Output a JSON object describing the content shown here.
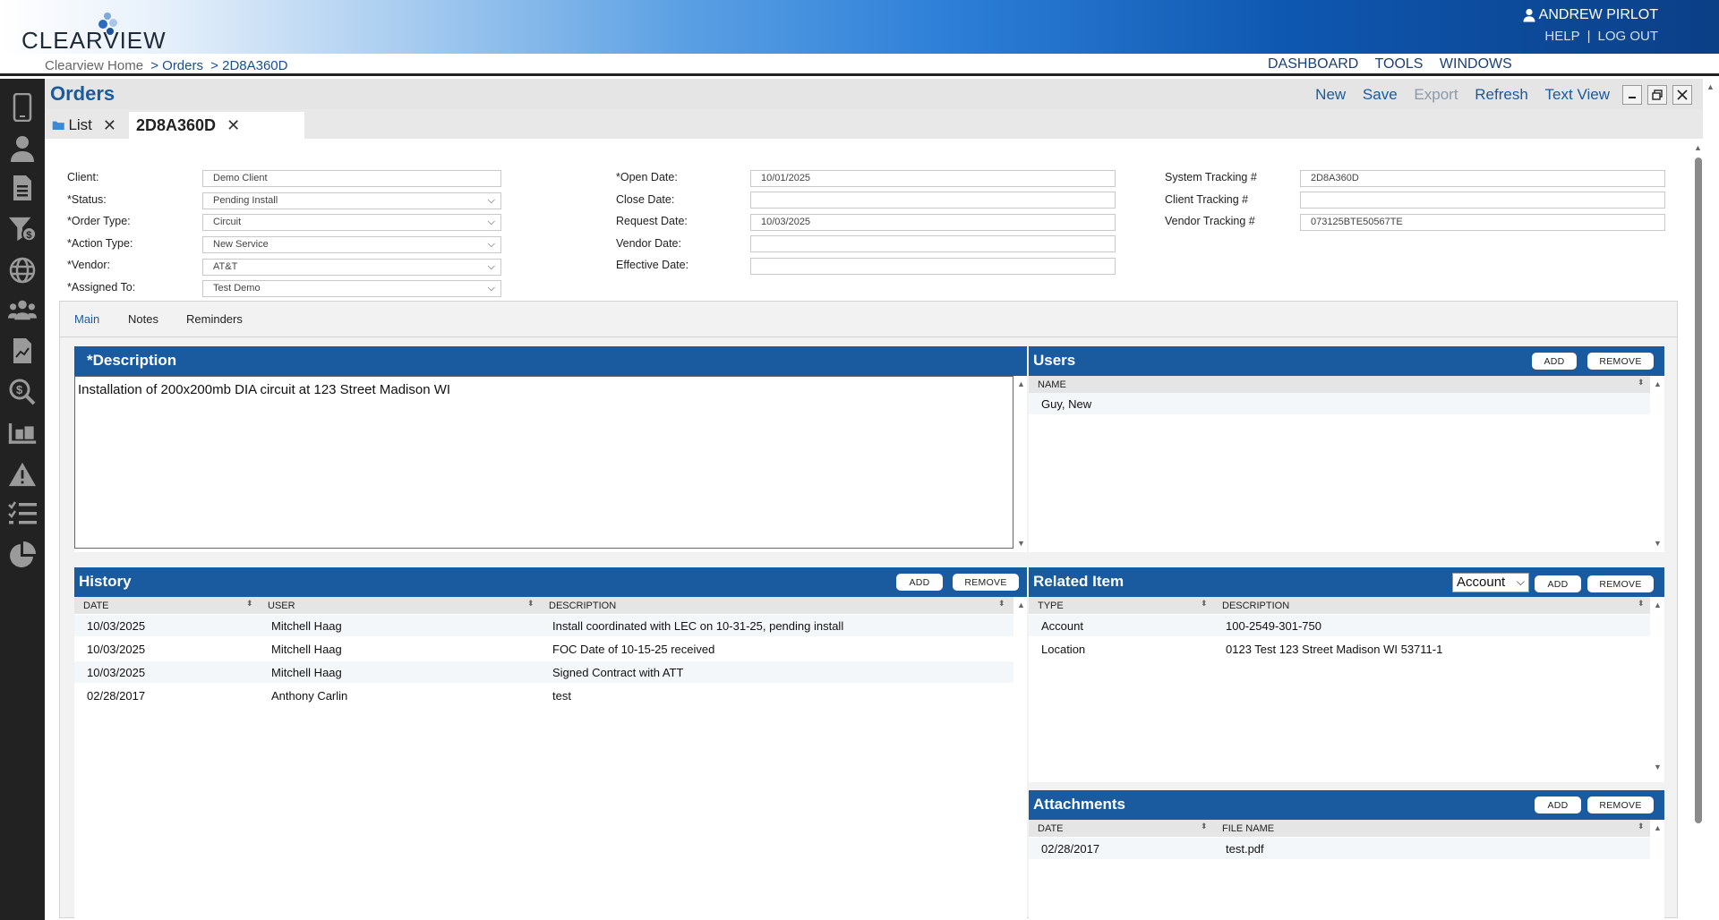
{
  "header": {
    "logo_text": "CLEARVIEW",
    "user_name": "ANDREW PIRLOT",
    "help": "HELP",
    "sep": "|",
    "logout": "LOG OUT"
  },
  "breadcrumb": {
    "items": [
      "Clearview Home",
      "> Orders",
      "> 2D8A360D"
    ]
  },
  "topnav": [
    "DASHBOARD",
    "TOOLS",
    "WINDOWS"
  ],
  "sidebar_icons": [
    "phone-icon",
    "user-icon",
    "document-icon",
    "funnel-dollar-icon",
    "globe-icon",
    "users-icon",
    "report-icon",
    "search-dollar-icon",
    "warehouse-icon",
    "warning-icon",
    "checklist-icon",
    "pie-chart-icon"
  ],
  "page": {
    "title": "Orders",
    "actions": {
      "new": "New",
      "save": "Save",
      "export": "Export",
      "refresh": "Refresh",
      "text_view": "Text View"
    },
    "tabs": [
      {
        "label": "List"
      },
      {
        "label": "2D8A360D"
      }
    ]
  },
  "form": {
    "client_label": "Client:",
    "client_value": "Demo Client",
    "status_label": "*Status:",
    "status_value": "Pending Install",
    "order_type_label": "*Order Type:",
    "order_type_value": "Circuit",
    "action_type_label": "*Action Type:",
    "action_type_value": "New Service",
    "vendor_label": "*Vendor:",
    "vendor_value": "AT&T",
    "assigned_label": "*Assigned To:",
    "assigned_value": "Test Demo",
    "open_date_label": "*Open Date:",
    "open_date_value": "10/01/2025",
    "close_date_label": "Close Date:",
    "close_date_value": "",
    "request_date_label": "Request Date:",
    "request_date_value": "10/03/2025",
    "vendor_date_label": "Vendor Date:",
    "vendor_date_value": "",
    "effective_date_label": "Effective Date:",
    "effective_date_value": "",
    "system_tracking_label": "System Tracking #",
    "system_tracking_value": "2D8A360D",
    "client_tracking_label": "Client Tracking #",
    "client_tracking_value": "",
    "vendor_tracking_label": "Vendor Tracking #",
    "vendor_tracking_value": "073125BTE50567TE"
  },
  "subtabs": [
    "Main",
    "Notes",
    "Reminders"
  ],
  "description": {
    "title": "*Description",
    "text": "Installation of 200x200mb DIA circuit at 123 Street Madison WI"
  },
  "users": {
    "title": "Users",
    "add": "ADD",
    "remove": "REMOVE",
    "col_name": "NAME",
    "rows": [
      "Guy, New"
    ]
  },
  "history": {
    "title": "History",
    "add": "ADD",
    "remove": "REMOVE",
    "cols": [
      "DATE",
      "USER",
      "DESCRIPTION"
    ],
    "rows": [
      {
        "date": "10/03/2025",
        "user": "Mitchell Haag",
        "desc": "Install coordinated with LEC on 10-31-25, pending install"
      },
      {
        "date": "10/03/2025",
        "user": "Mitchell Haag",
        "desc": "FOC Date of 10-15-25 received"
      },
      {
        "date": "10/03/2025",
        "user": "Mitchell Haag",
        "desc": "Signed Contract with ATT"
      },
      {
        "date": "02/28/2017",
        "user": "Anthony Carlin",
        "desc": "test"
      }
    ]
  },
  "related": {
    "title": "Related Item",
    "select_value": "Account",
    "add": "ADD",
    "remove": "REMOVE",
    "cols": [
      "TYPE",
      "DESCRIPTION"
    ],
    "rows": [
      {
        "type": "Account",
        "desc": "100-2549-301-750"
      },
      {
        "type": "Location",
        "desc": "0123 Test 123 Street Madison WI 53711-1"
      }
    ]
  },
  "attachments": {
    "title": "Attachments",
    "add": "ADD",
    "remove": "REMOVE",
    "cols": [
      "DATE",
      "FILE NAME"
    ],
    "rows": [
      {
        "date": "02/28/2017",
        "file": "test.pdf"
      }
    ]
  },
  "colors": {
    "brand_blue": "#1a5a9e",
    "sidebar": "#222222",
    "header_dark": "#0b3f86"
  }
}
